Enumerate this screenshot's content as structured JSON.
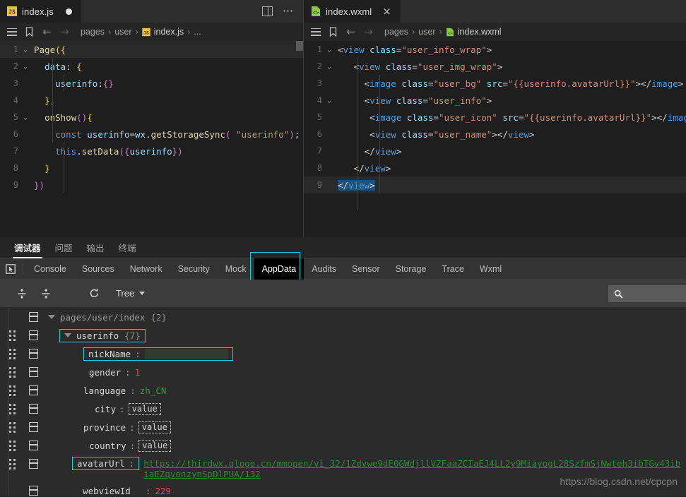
{
  "editors": {
    "left": {
      "tab": {
        "name": "index.js",
        "icon": "js-file-icon",
        "modified_dot": "●"
      },
      "actions": {
        "split_icon": "split-editor-icon",
        "more_icon": "more-actions-icon"
      },
      "breadcrumb": {
        "menu_icon": "outline-icon",
        "bookmark_icon": "bookmark-icon",
        "back_icon": "←",
        "forward_icon": "→",
        "parts": [
          "pages",
          "user",
          "index.js",
          "..."
        ],
        "separator": "›"
      },
      "lines": [
        {
          "n": "1",
          "fold": "⌄"
        },
        {
          "n": "2",
          "fold": "⌄"
        },
        {
          "n": "3",
          "fold": ""
        },
        {
          "n": "4",
          "fold": ""
        },
        {
          "n": "5",
          "fold": "⌄"
        },
        {
          "n": "6",
          "fold": ""
        },
        {
          "n": "7",
          "fold": ""
        },
        {
          "n": "8",
          "fold": ""
        },
        {
          "n": "9",
          "fold": ""
        }
      ],
      "code": [
        "Page({",
        "  data: {",
        "    userinfo:{}",
        "  },",
        "  onShow(){",
        "    const userinfo=wx.getStorageSync( \"userinfo\");",
        "    this.setData({userinfo})",
        "  }",
        "})"
      ]
    },
    "right": {
      "tab": {
        "name": "index.wxml",
        "icon": "wxml-file-icon",
        "close": "×"
      },
      "breadcrumb": {
        "menu_icon": "outline-icon",
        "bookmark_icon": "bookmark-icon",
        "back_icon": "←",
        "forward_icon": "→",
        "parts": [
          "pages",
          "user",
          "index.wxml"
        ],
        "separator": "›"
      },
      "lines": [
        {
          "n": "1",
          "fold": "⌄"
        },
        {
          "n": "2",
          "fold": "⌄"
        },
        {
          "n": "3",
          "fold": ""
        },
        {
          "n": "4",
          "fold": "⌄"
        },
        {
          "n": "5",
          "fold": ""
        },
        {
          "n": "6",
          "fold": ""
        },
        {
          "n": "7",
          "fold": ""
        },
        {
          "n": "8",
          "fold": ""
        },
        {
          "n": "9",
          "fold": ""
        }
      ],
      "code": [
        "<view class=\"user_info_wrap\">",
        "    <view class=\"user_img_wrap\">",
        "      <image class=\"user_bg\" src=\"{{userinfo.avatarUrl}}\"></image>",
        "      <view class=\"user_info\">",
        "       <image class=\"user_icon\" src=\"{{userinfo.avatarUrl}}\"></image>",
        "       <view class=\"user_name\"></view>",
        "      </view>",
        "    </view>",
        "</view>"
      ]
    }
  },
  "devtools": {
    "panel_tabs": [
      {
        "label": "调试器",
        "active": true
      },
      {
        "label": "问题",
        "active": false
      },
      {
        "label": "输出",
        "active": false
      },
      {
        "label": "终端",
        "active": false
      }
    ],
    "inspect_icon": "inspect-element-icon",
    "tabs": [
      {
        "label": "Console",
        "active": false
      },
      {
        "label": "Sources",
        "active": false
      },
      {
        "label": "Network",
        "active": false
      },
      {
        "label": "Security",
        "active": false
      },
      {
        "label": "Mock",
        "active": false
      },
      {
        "label": "AppData",
        "active": true
      },
      {
        "label": "Audits",
        "active": false
      },
      {
        "label": "Sensor",
        "active": false
      },
      {
        "label": "Storage",
        "active": false
      },
      {
        "label": "Trace",
        "active": false
      },
      {
        "label": "Wxml",
        "active": false
      }
    ],
    "toolbar": {
      "expand_all_icon": "expand-all-icon",
      "collapse_all_icon": "collapse-all-icon",
      "refresh_icon": "refresh-icon",
      "view_mode": "Tree",
      "view_mode_caret": "chevron-down-icon",
      "search": {
        "icon": "search-icon",
        "value": "",
        "placeholder": ""
      }
    },
    "tree": {
      "root": {
        "label": "pages/user/index",
        "count": "{2}",
        "toggle": "expanded"
      },
      "nodes": [
        {
          "key": "userinfo",
          "count": "{7}",
          "toggle": "expanded",
          "highlight": true,
          "indent": 1
        },
        {
          "key": "nickName",
          "value_type": "redacted",
          "value": "",
          "highlight": true,
          "indent": 2
        },
        {
          "key": "gender",
          "value_type": "number",
          "value": "1",
          "indent": 2
        },
        {
          "key": "language",
          "value_type": "string",
          "value": "zh_CN",
          "indent": 2
        },
        {
          "key": "city",
          "value_type": "placeholder",
          "value": "value",
          "indent": 2
        },
        {
          "key": "province",
          "value_type": "placeholder",
          "value": "value",
          "indent": 2
        },
        {
          "key": "country",
          "value_type": "placeholder",
          "value": "value",
          "indent": 2
        },
        {
          "key": "avatarUrl",
          "value_type": "link",
          "value": "https://thirdwx.qlogo.cn/mmopen/vi_32/1Zdvwe9dE0GWdjllVZFaaZCIaEJ4LL2y9MiayogL28SzfmSjNwteh3ibTGv43ibiaEZqvonzynSpDlPUA/132",
          "highlight": true,
          "indent": 2
        },
        {
          "key": "__webviewId__",
          "value_type": "number",
          "value": "229",
          "indent": 1
        }
      ]
    }
  },
  "watermark": "https://blog.csdn.net/cpcpn",
  "colors": {
    "accent_highlight": "#19d1d1",
    "editor_bg": "#1e1e1e",
    "devtools_bg": "#2b2b2b",
    "link_green": "#2e8b2e",
    "number_red": "#e04a4a"
  }
}
